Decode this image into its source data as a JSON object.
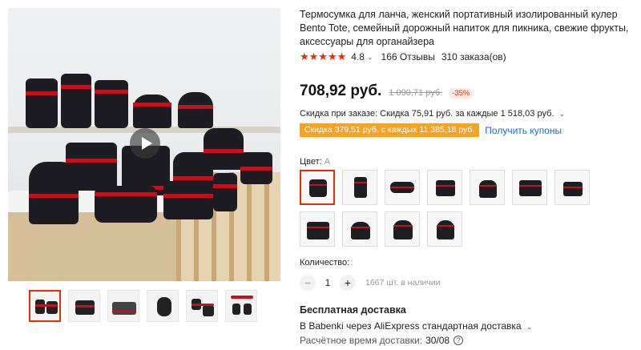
{
  "product": {
    "title": "Термосумка для ланча, женский портативный изолированный кулер Bento Tote, семейный дорожный напиток для пикника, свежие фрукты, аксессуары для органайзера",
    "rating": "4.8",
    "stars": "★★★★★",
    "reviews": "166 Отзывы",
    "orders": "310 заказа(ов)"
  },
  "price": {
    "current": "708,92 руб.",
    "old": "1 090,71 руб.",
    "discount": "-35%"
  },
  "promo": {
    "order_discount": "Скидка при заказе: Скидка 75,91 руб. за каждые 1 518,03 руб.",
    "coupon": "Скидка 379,51 руб. с каждых 11 385,18 руб.",
    "get_coupons": "Получить купоны"
  },
  "color": {
    "label": "Цвет:",
    "value": "A"
  },
  "quantity": {
    "label": "Количество:",
    "value": "1",
    "minus": "−",
    "plus": "+",
    "stock": "1667 шт. в наличии"
  },
  "shipping": {
    "title": "Бесплатная доставка",
    "route": "В Babenki через AliExpress стандартная доставка",
    "eta_label": "Расчётное время доставки:",
    "eta_date": "30/08",
    "help": "?"
  },
  "icons": {
    "chevron": "⌄",
    "play": "play-icon"
  },
  "colors": {
    "accent": "#e62e04",
    "coupon_bg": "#f3a325",
    "link": "#1e6cc7",
    "bag": "#1c1c22",
    "bag_trim": "#c1121f"
  }
}
